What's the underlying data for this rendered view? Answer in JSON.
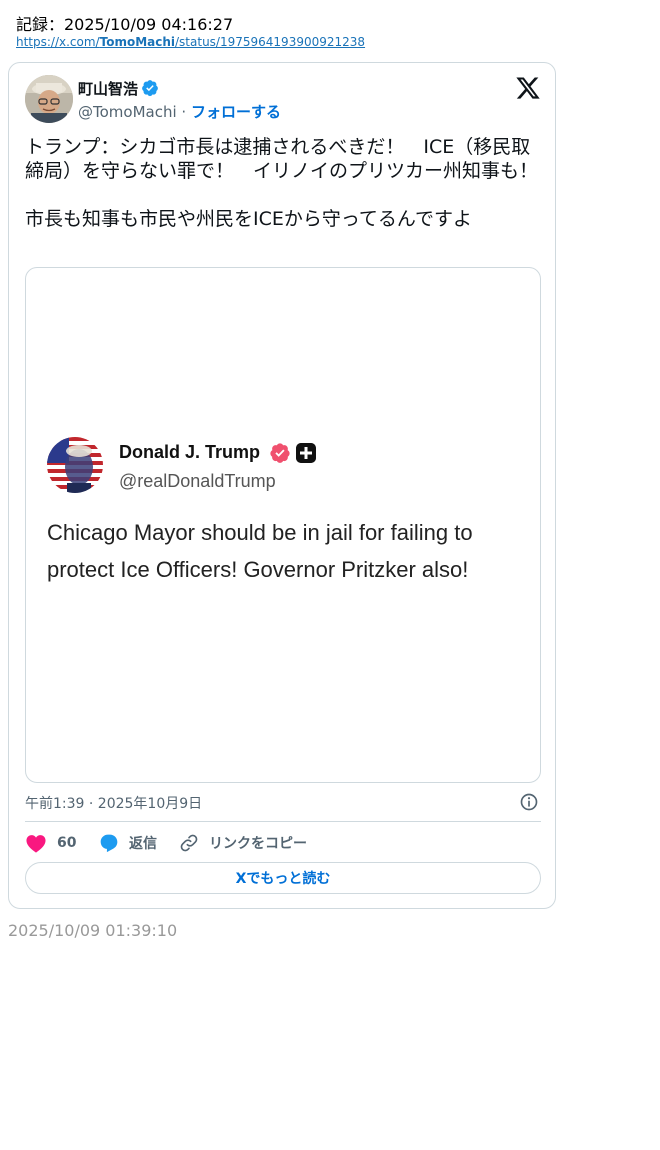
{
  "record": {
    "label": "記録：2025/10/09 04:16:27",
    "url_prefix": "https://x.com/",
    "url_user": "TomoMachi",
    "url_suffix": "/status/1975964193900921238"
  },
  "tweet": {
    "display_name": "町山智浩",
    "handle": "@TomoMachi",
    "separator": " · ",
    "follow_label": "フォローする",
    "text": "トランプ：シカゴ市長は逮捕されるべきだ！　ICE（移民取締局）を守らない罪で！　イリノイのプリツカー州知事も！\n\n市長も知事も市民や州民をICEから守ってるんですよ",
    "timestamp": "午前1:39 · 2025年10月9日",
    "like_count": "60",
    "reply_label": "返信",
    "copy_link_label": "リンクをコピー",
    "read_more_label": "Xでもっと読む"
  },
  "media": {
    "name": "Donald J. Trump",
    "handle": "@realDonaldTrump",
    "text": "Chicago Mayor should be in jail for failing to protect Ice Officers! Governor Pritzker also!"
  },
  "saved_time": "2025/10/09 01:39:10",
  "colors": {
    "accent": "#006fd6",
    "like": "#f91880",
    "reply": "#1d9bf0",
    "verified": "#1d9bf0",
    "trump_verified": "#f0506e"
  },
  "icons": [
    "verified-badge-icon",
    "x-logo-icon",
    "info-icon",
    "heart-icon",
    "reply-bubble-icon",
    "link-icon",
    "plus-badge-icon"
  ]
}
